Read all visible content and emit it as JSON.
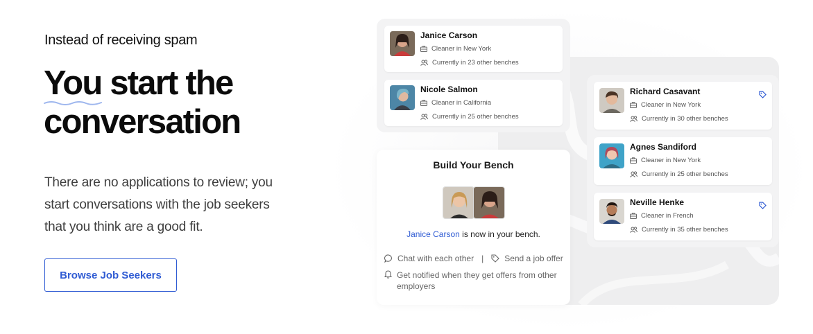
{
  "hero": {
    "eyebrow": "Instead of receiving spam",
    "headline_line1_a": "You",
    "headline_line1_b": " start the",
    "headline_line2": "conversation",
    "body": "There are no applications to review; you start conversations with the job seekers that you think are a good fit.",
    "cta_label": "Browse Job Seekers"
  },
  "colors": {
    "accent": "#2f5bd3",
    "squiggle": "#9fb7ee",
    "panel_bg": "#f3f3f4",
    "bg_shape": "#eeeeef"
  },
  "left_panel": {
    "profiles": [
      {
        "name": "Janice Carson",
        "role": "Cleaner in New York",
        "benches": "Currently in 23 other benches"
      },
      {
        "name": "Nicole Salmon",
        "role": "Cleaner in California",
        "benches": "Currently in 25 other benches"
      }
    ]
  },
  "right_panel": {
    "profiles": [
      {
        "name": "Richard Casavant",
        "role": "Cleaner in New York",
        "benches": "Currently in 30 other benches",
        "tagged": true
      },
      {
        "name": "Agnes Sandiford",
        "role": "Cleaner in New York",
        "benches": "Currently in 25 other benches",
        "tagged": false
      },
      {
        "name": "Neville Henke",
        "role": "Cleaner in French",
        "benches": "Currently in 35 other benches",
        "tagged": true
      }
    ]
  },
  "bench_card": {
    "title": "Build Your Bench",
    "added_name": "Janice Carson",
    "added_suffix": " is now in your bench.",
    "feature_chat": "Chat with each other",
    "separator": "|",
    "feature_offer": "Send a job offer",
    "feature_notify": "Get notified when they get offers from other employers"
  },
  "icons": {
    "briefcase": "briefcase-icon",
    "people": "people-icon",
    "tag": "tag-icon",
    "chat": "chat-bubble-icon",
    "bell": "bell-icon"
  }
}
